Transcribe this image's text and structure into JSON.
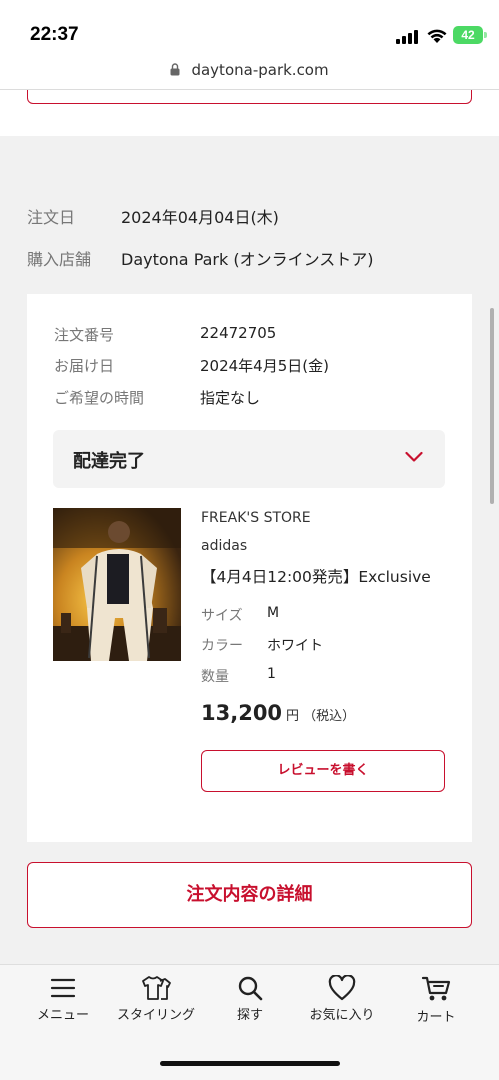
{
  "status_bar": {
    "time": "22:37",
    "battery": "42"
  },
  "browser": {
    "url": "daytona-park.com"
  },
  "order": {
    "date_label": "注文日",
    "date": "2024年04月04日(木)",
    "store_label": "購入店舗",
    "store": "Daytona Park (オンラインストア)"
  },
  "shipment": {
    "number_label": "注文番号",
    "number": "22472705",
    "delivery_label": "お届け日",
    "delivery": "2024年4月5日(金)",
    "time_label": "ご希望の時間",
    "time": "指定なし",
    "status": "配達完了"
  },
  "product": {
    "shop": "FREAK'S STORE",
    "brand": "adidas",
    "name": "【4月4日12:00発売】Exclusive",
    "size_label": "サイズ",
    "size": "M",
    "color_label": "カラー",
    "color": "ホワイト",
    "qty_label": "数量",
    "qty": "1",
    "price": "13,200",
    "price_unit": "円",
    "price_tax": "（税込）",
    "review_button": "レビューを書く"
  },
  "detail_button": "注文内容の詳細",
  "tabs": [
    {
      "label": "メニュー",
      "icon": "menu-icon"
    },
    {
      "label": "スタイリング",
      "icon": "styling-icon"
    },
    {
      "label": "探す",
      "icon": "search-icon"
    },
    {
      "label": "お気に入り",
      "icon": "heart-icon"
    },
    {
      "label": "カート",
      "icon": "cart-icon"
    }
  ],
  "colors": {
    "accent": "#c8102e",
    "battery": "#4cd964",
    "page_bg": "#f1f1f1"
  }
}
